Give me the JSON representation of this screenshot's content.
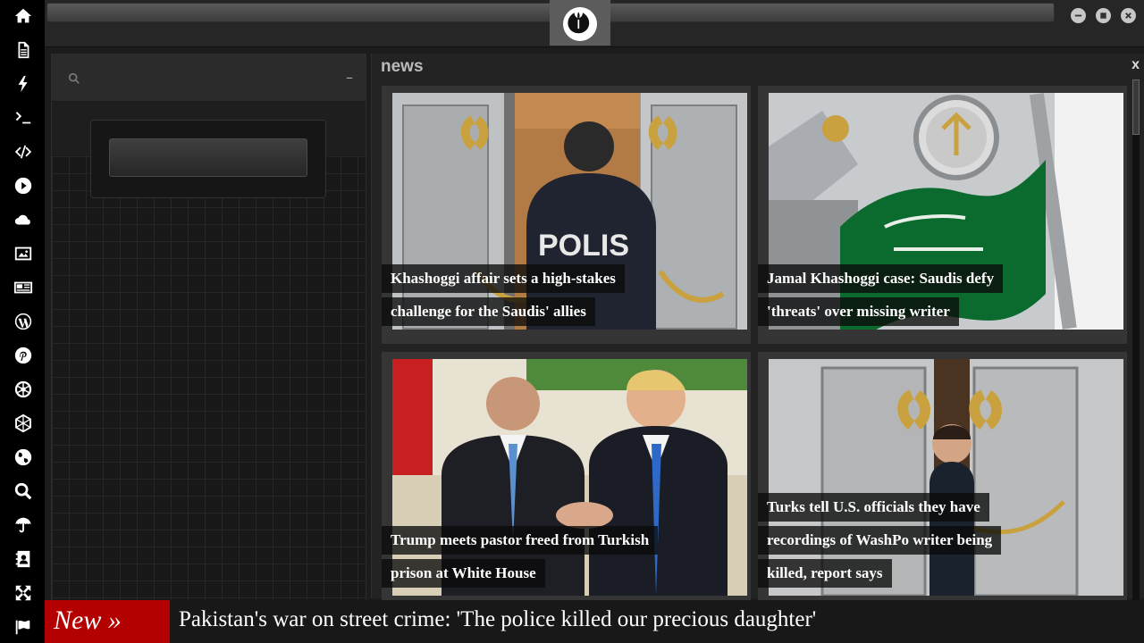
{
  "sidebar": {
    "icons": [
      "home-icon",
      "document-icon",
      "lightning-icon",
      "terminal-icon",
      "code-icon",
      "play-icon",
      "cloud-icon",
      "image-icon",
      "newspaper-icon",
      "wordpress-icon",
      "pinterest-icon",
      "aperture-icon",
      "network-icon",
      "globe-icon",
      "search-icon",
      "umbrella-icon",
      "contact-card-icon",
      "expand-icon",
      "flag-icon"
    ]
  },
  "news_panel": {
    "title": "news",
    "close_label": "x",
    "articles": [
      {
        "headline": "Khashoggi affair sets a high-stakes challenge for the Saudis' allies"
      },
      {
        "headline": "Jamal Khashoggi case: Saudis defy 'threats' over missing writer"
      },
      {
        "headline": "Trump meets pastor freed from Turkish prison at White House"
      },
      {
        "headline": "Turks tell U.S. officials they have recordings of WashPo writer being killed, report says"
      }
    ]
  },
  "left_panel": {
    "minimize_label": "–"
  },
  "ticker": {
    "label": "New »",
    "headline": "Pakistan's war on street crime: 'The police killed our precious daughter'"
  },
  "colors": {
    "ticker_label_bg": "#b30000",
    "sidebar_bg": "#000000",
    "panel_bg": "#232323"
  }
}
